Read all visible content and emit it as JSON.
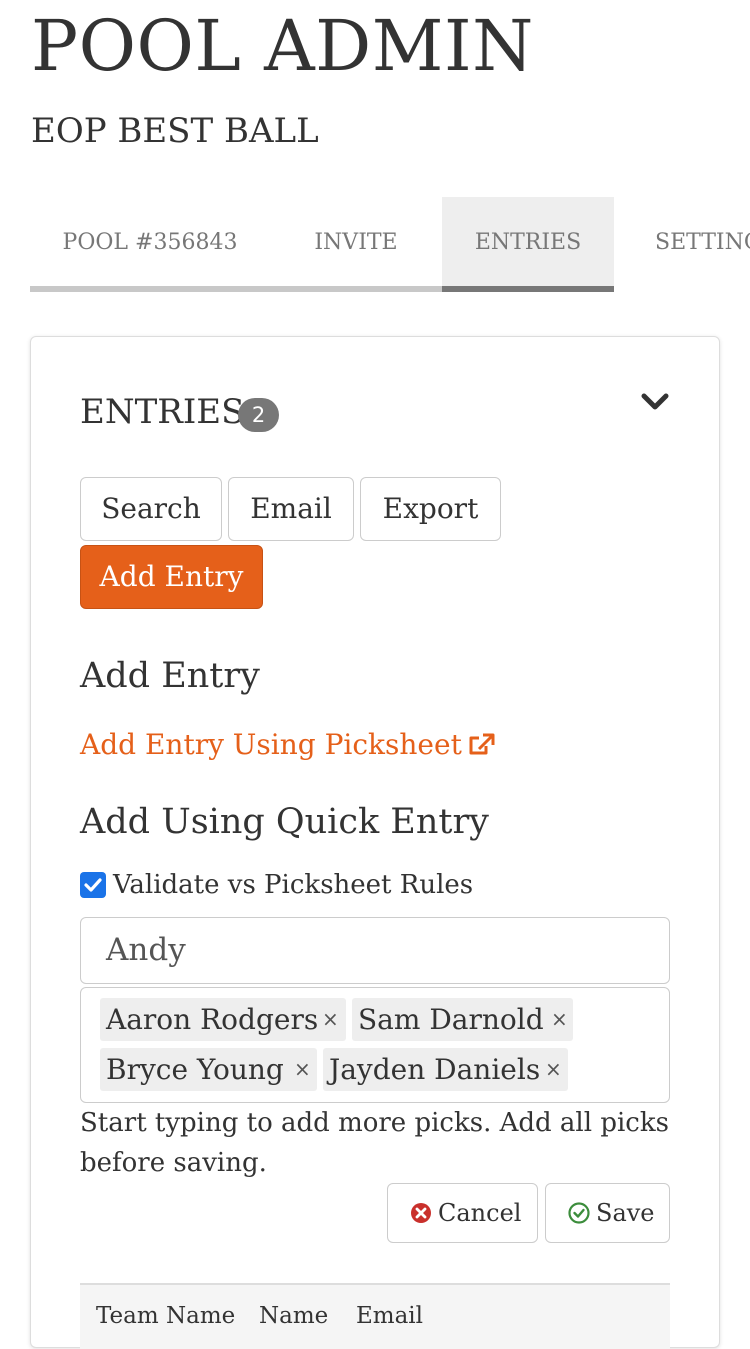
{
  "header": {
    "title": "POOL ADMIN",
    "pool_name": "EOP BEST BALL"
  },
  "tabs": [
    {
      "label": "POOL #356843",
      "active": false
    },
    {
      "label": "INVITE",
      "active": false
    },
    {
      "label": "ENTRIES",
      "active": true
    },
    {
      "label": "SETTINGS",
      "active": false
    }
  ],
  "entries_panel": {
    "title": "ENTRIES",
    "count": "2",
    "collapse_icon": "chevron-down-icon",
    "buttons": {
      "search": "Search",
      "email": "Email",
      "export": "Export",
      "add_entry": "Add Entry"
    }
  },
  "add_entry": {
    "heading": "Add Entry",
    "picksheet_link": "Add Entry Using Picksheet",
    "picksheet_link_icon": "external-link-icon",
    "quick_heading": "Add Using Quick Entry",
    "validate_label": "Validate vs Picksheet Rules",
    "validate_checked": true,
    "name_value": "Andy",
    "picks": [
      {
        "name": "Aaron Rodgers",
        "remove": "×"
      },
      {
        "name": "Sam Darnold",
        "remove": "×"
      },
      {
        "name": "Bryce Young",
        "remove": "×"
      },
      {
        "name": "Jayden Daniels",
        "remove": "×"
      }
    ],
    "helper_text": "Start typing to add more picks. Add all picks before saving.",
    "cancel_label": "Cancel",
    "save_label": "Save"
  },
  "table": {
    "columns": [
      "Team Name",
      "Name",
      "Email"
    ]
  },
  "colors": {
    "accent": "#e5601a",
    "badge": "#777777",
    "checkbox": "#1a73e8",
    "cancel_icon": "#c9302c",
    "save_icon": "#3c8d3c"
  }
}
